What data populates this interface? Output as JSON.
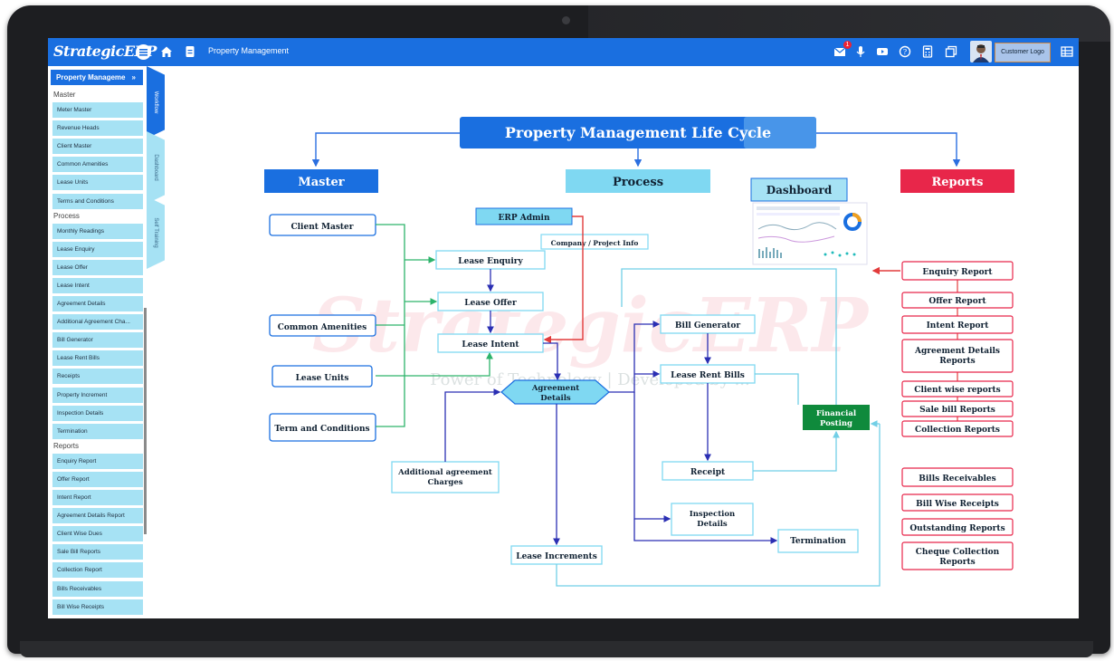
{
  "app": {
    "logo": "StrategicERP",
    "title": "Property Management",
    "notification_count": "1",
    "customer_logo": "Customer Logo"
  },
  "sidebar": {
    "header": "Property Manageme",
    "sections": [
      {
        "title": "Master",
        "items": [
          "Meter Master",
          "Revenue Heads",
          "Client Master",
          "Common Amenities",
          "Lease Units",
          "Terms and Conditions"
        ]
      },
      {
        "title": "Process",
        "items": [
          "Monthly Readings",
          "Lease Enquiry",
          "Lease Offer",
          "Lease Intent",
          "Agreement Details",
          "Additional Agreement Cha...",
          "Bill Generator",
          "Lease Rent Bills",
          "Receipts",
          "Property Increment",
          "Inspection Details",
          "Termination"
        ]
      },
      {
        "title": "Reports",
        "items": [
          "Enquiry Report",
          "Offer Report",
          "Intent Report",
          "Agreement Details Report",
          "Client Wise Dues",
          "Sale Bill Reports",
          "Collection Report",
          "Bills Receivables",
          "Bill Wise Receipts"
        ]
      }
    ]
  },
  "vtabs": [
    "Workflow",
    "Dashboard",
    "Self Training"
  ],
  "diagram": {
    "title": "Property Management Life Cycle",
    "watermark": "StrategicERP",
    "watermark_sub": "Power of Technology | Developed by ...",
    "headers": {
      "master": "Master",
      "process": "Process",
      "dashboard": "Dashboard",
      "reports": "Reports"
    },
    "master_nodes": [
      "Client Master",
      "Common Amenities",
      "Lease Units",
      "Term and Conditions"
    ],
    "process_nodes": {
      "erp_admin": "ERP Admin",
      "company_info": "Company / Project Info",
      "lease_enquiry": "Lease Enquiry",
      "lease_offer": "Lease Offer",
      "lease_intent": "Lease Intent",
      "agreement_details_1": "Agreement",
      "agreement_details_2": "Details",
      "additional_1": "Additional agreement",
      "additional_2": "Charges",
      "lease_increments": "Lease Increments",
      "bill_generator": "Bill Generator",
      "lease_rent_bills": "Lease Rent Bills",
      "receipt": "Receipt",
      "financial_posting_1": "Financial",
      "financial_posting_2": "Posting",
      "inspection_1": "Inspection",
      "inspection_2": "Details",
      "termination": "Termination"
    },
    "report_nodes": [
      [
        "Enquiry Report"
      ],
      [
        "Offer Report"
      ],
      [
        "Intent Report"
      ],
      [
        "Agreement Details",
        "Reports"
      ],
      [
        "Client wise reports"
      ],
      [
        "Sale bill Reports"
      ],
      [
        "Collection Reports"
      ],
      [
        "Bills Receivables"
      ],
      [
        "Bill Wise Receipts"
      ],
      [
        "Outstanding Reports"
      ],
      [
        "Cheque Collection",
        "Reports"
      ]
    ],
    "colors": {
      "blue": "#1a6fe0",
      "light": "#7fd8f2",
      "red": "#e8264a",
      "green": "#0f8a3c",
      "flow_green": "#2db36b",
      "flow_red": "#e23b3b",
      "flow_navy": "#2b2fb3",
      "teal": "#72cfe6"
    }
  }
}
